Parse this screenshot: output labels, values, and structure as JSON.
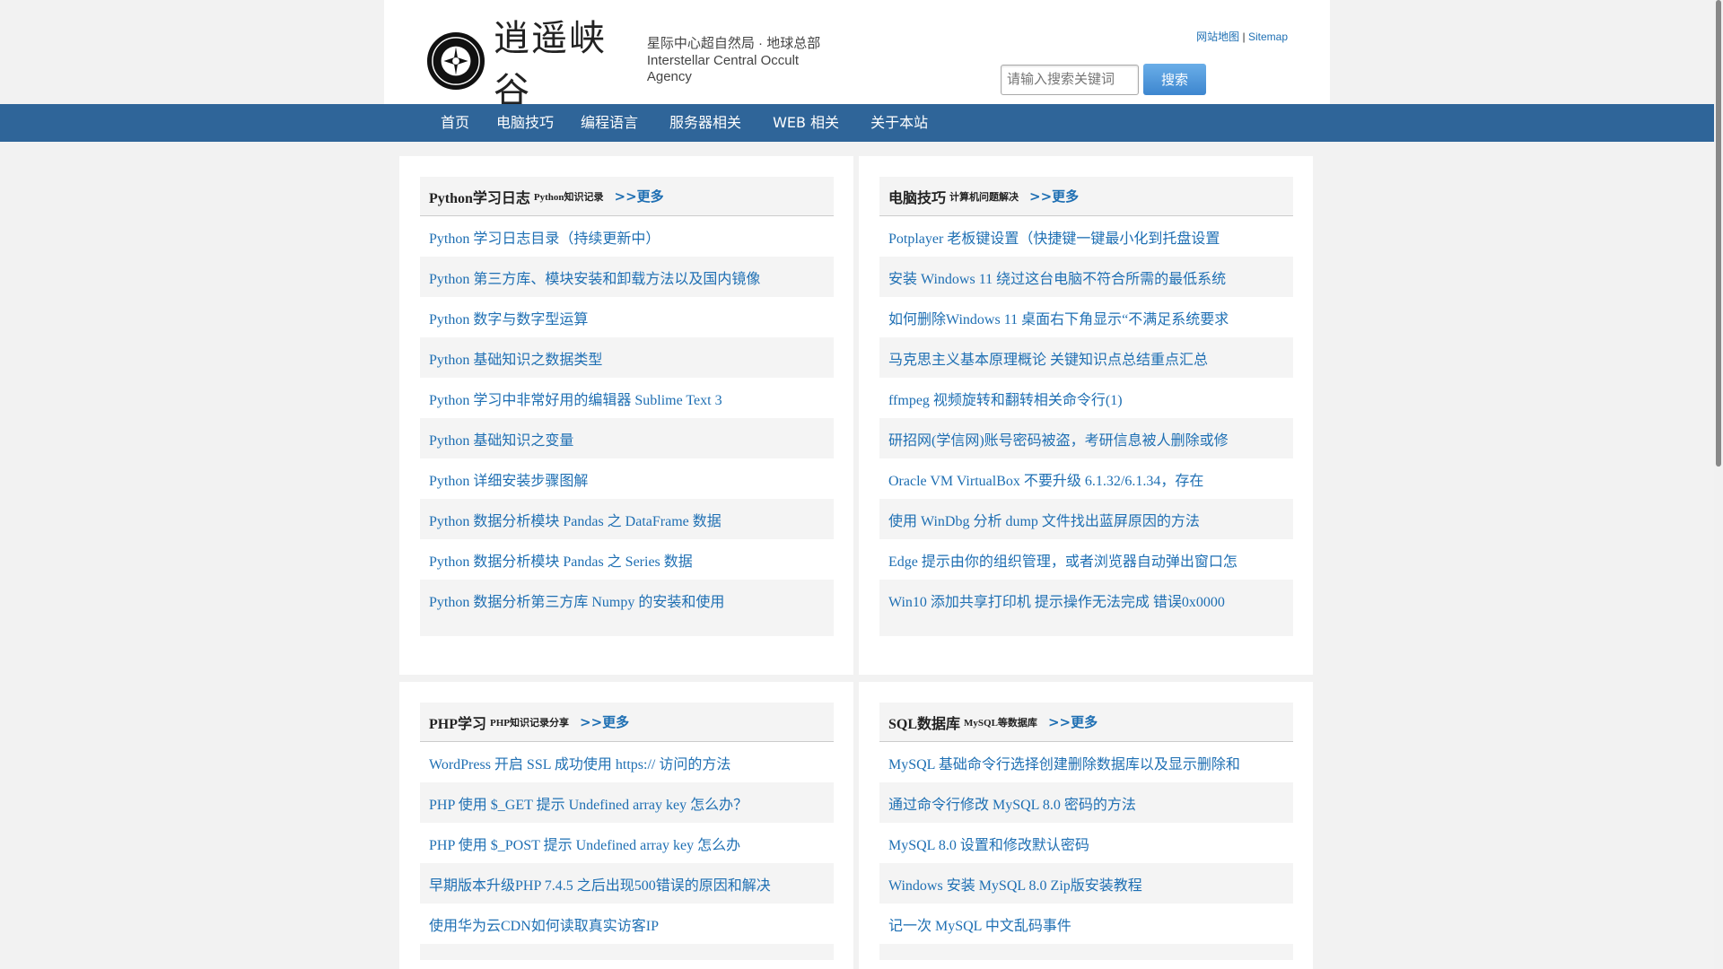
{
  "brand": {
    "name_cn": "逍遥峡谷",
    "tagline_cn": "星际中心超自然局 · 地球总部",
    "tagline_en": "Interstellar Central Occult Agency"
  },
  "toplinks": {
    "sitemap_cn": "网站地图",
    "separator": "|",
    "sitemap_en": "Sitemap"
  },
  "search": {
    "placeholder": "请输入搜索关键词",
    "button": "搜索"
  },
  "nav": [
    "首页",
    "电脑技巧",
    "编程语言",
    "服务器相关",
    "WEB 相关",
    "关于本站"
  ],
  "colors": {
    "nav_bg": "#2f6599",
    "link": "#1e6fb3",
    "row_alt": "#f4f4f4"
  },
  "panels": [
    {
      "title": "Python学习日志",
      "sub": "Python知识记录",
      "more": ">>更多",
      "items": [
        "Python 学习日志目录（持续更新中）",
        "Python 第三方库、模块安装和卸载方法以及国内镜像",
        "Python 数字与数字型运算",
        "Python 基础知识之数据类型",
        "Python 学习中非常好用的编辑器 Sublime Text 3",
        "Python 基础知识之变量",
        "Python 详细安装步骤图解",
        "Python 数据分析模块 Pandas 之 DataFrame 数据",
        "Python 数据分析模块 Pandas 之 Series 数据",
        "Python 数据分析第三方库 Numpy 的安装和使用"
      ]
    },
    {
      "title": "电脑技巧",
      "sub": "计算机问题解决",
      "more": ">>更多",
      "items": [
        "Potplayer 老板键设置（快捷键一键最小化到托盘设置",
        "安装 Windows 11 绕过这台电脑不符合所需的最低系统",
        "如何删除Windows 11 桌面右下角显示“不满足系统要求",
        "马克思主义基本原理概论 关键知识点总结重点汇总",
        "ffmpeg 视频旋转和翻转相关命令行(1)",
        "研招网(学信网)账号密码被盗，考研信息被人删除或修",
        "Oracle VM VirtualBox 不要升级 6.1.32/6.1.34，存在",
        "使用 WinDbg 分析 dump 文件找出蓝屏原因的方法",
        "Edge 提示由你的组织管理，或者浏览器自动弹出窗口怎",
        "Win10 添加共享打印机 提示操作无法完成 错误0x0000"
      ]
    },
    {
      "title": "PHP学习",
      "sub": "PHP知识记录分享",
      "more": ">>更多",
      "items": [
        "WordPress 开启 SSL 成功使用 https:// 访问的方法",
        "PHP 使用 $_GET 提示 Undefined array key 怎么办？",
        "PHP 使用 $_POST 提示 Undefined array key 怎么办",
        "早期版本升级PHP 7.4.5 之后出现500错误的原因和解决",
        "使用华为云CDN如何读取真实访客IP"
      ]
    },
    {
      "title": "SQL数据库",
      "sub": "MySQL等数据库",
      "more": ">>更多",
      "items": [
        "MySQL 基础命令行选择创建删除数据库以及显示删除和",
        "通过命令行修改 MySQL 8.0 密码的方法",
        "MySQL 8.0 设置和修改默认密码",
        "Windows 安装 MySQL 8.0 Zip版安装教程",
        "记一次 MySQL 中文乱码事件"
      ]
    }
  ]
}
